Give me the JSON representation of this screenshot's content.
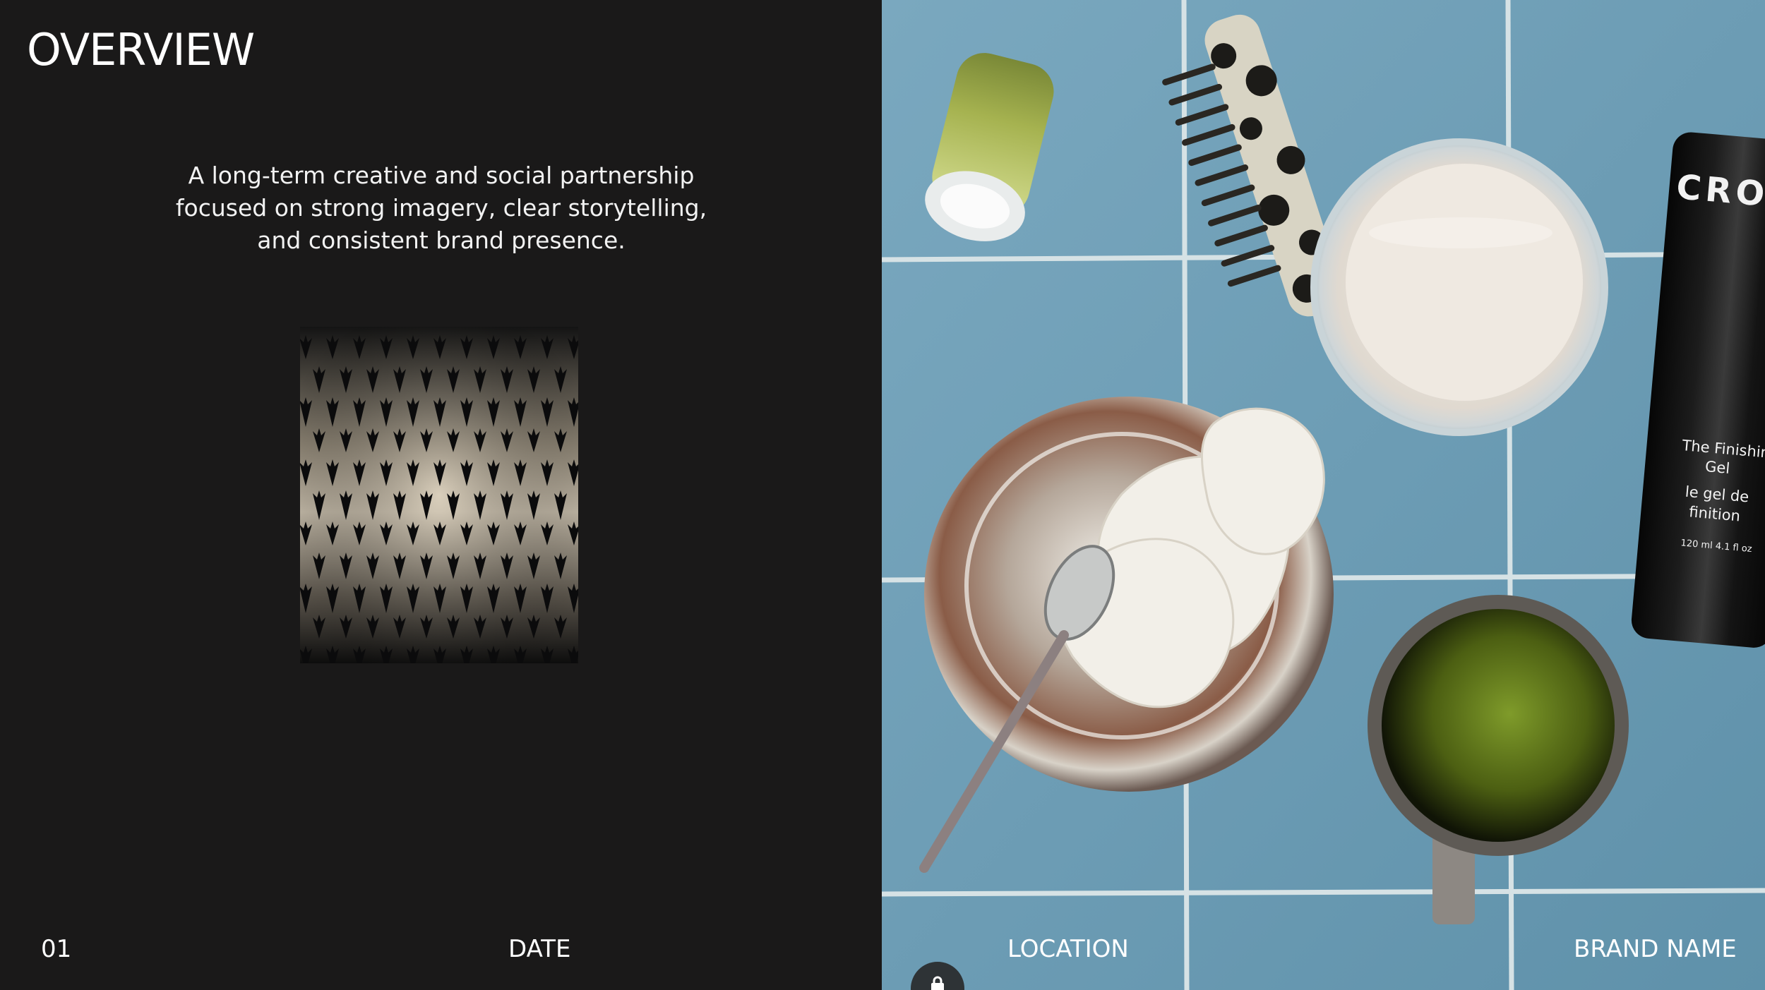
{
  "slide": {
    "title": "OVERVIEW",
    "intro_lines": [
      "A long-term creative and social partnership",
      "focused on strong imagery, clear storytelling,",
      "and consistent brand presence."
    ],
    "footer": {
      "page_number": "01",
      "date_label": "DATE",
      "location_label": "LOCATION",
      "brand_label": "BRAND NAME"
    }
  },
  "product_tube": {
    "brand_fragment": "CRO",
    "name_line1": "The Finishin",
    "name_line2": "Gel",
    "french_line1": "le gel de",
    "french_line2": "finition",
    "volume": "120 ml  4.1 fl oz"
  },
  "badge": {
    "icon": "lock-icon"
  },
  "colors": {
    "background": "#1a1919",
    "text": "#ffffff",
    "tile": "#6f9db4",
    "grout": "#dfe8ea"
  }
}
